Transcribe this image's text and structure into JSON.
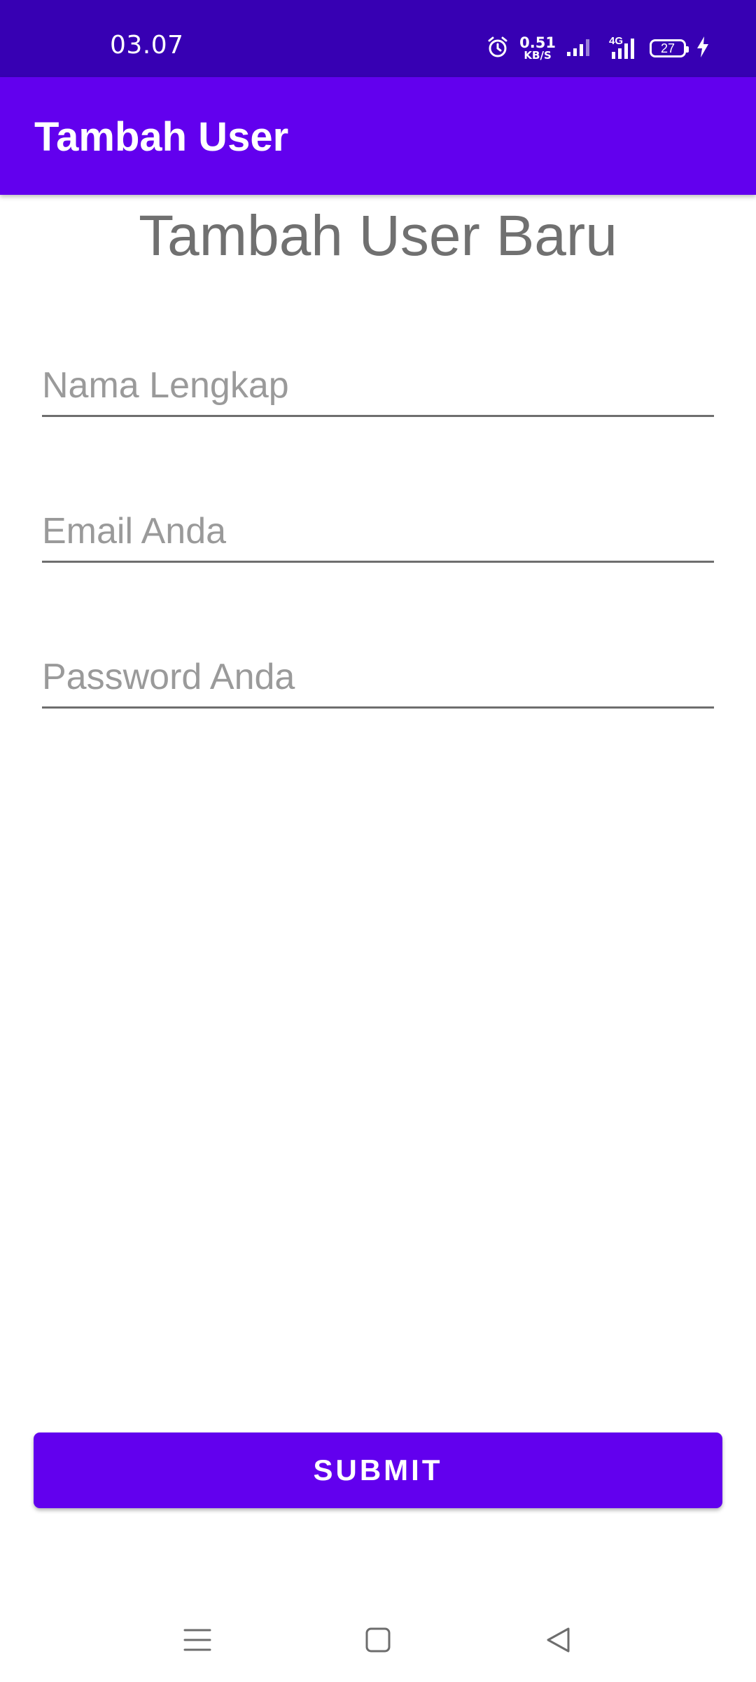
{
  "status_bar": {
    "time": "03.07",
    "speed_value": "0.51",
    "speed_unit": "KB/S",
    "network": "4G",
    "battery": "27"
  },
  "app_bar": {
    "title": "Tambah User"
  },
  "form": {
    "heading": "Tambah User Baru",
    "name_placeholder": "Nama Lengkap",
    "email_placeholder": "Email Anda",
    "password_placeholder": "Password Anda",
    "submit_label": "SUBMIT"
  },
  "nav_bar": {
    "icons": [
      "menu-icon",
      "home-icon",
      "back-icon"
    ]
  },
  "colors": {
    "status_bar": "#3700B3",
    "primary": "#6200EE"
  }
}
